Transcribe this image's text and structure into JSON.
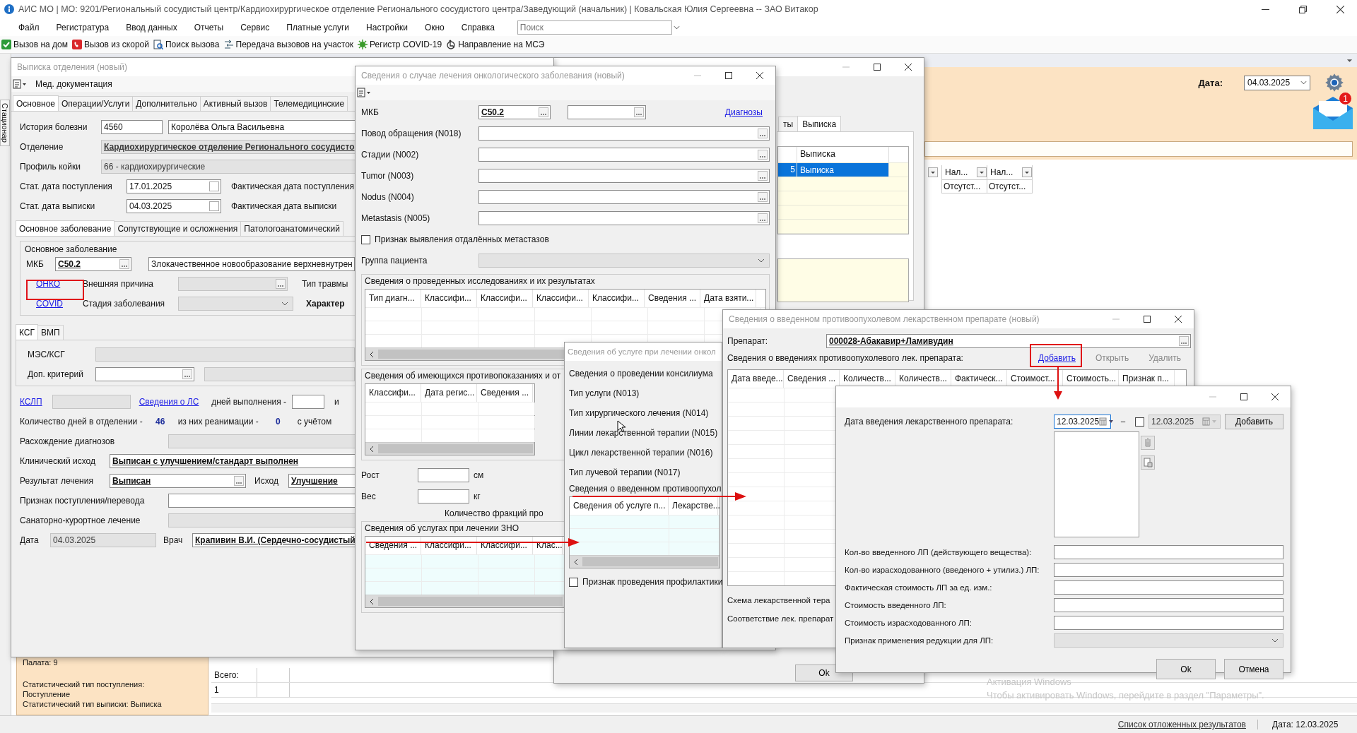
{
  "app": {
    "title": "АИС МО | МО: 9201/Региональный сосудистый центр/Кардиохирургическое отделение Регионального сосудистого центра/Заведующий (начальник) | Ковальская Юлия Сергеевна -- ЗАО Витакор",
    "menu": [
      "Файл",
      "Регистратура",
      "Ввод данных",
      "Отчеты",
      "Сервис",
      "Платные услуги",
      "Настройки",
      "Окно",
      "Справка"
    ],
    "search": {
      "placeholder": "Поиск"
    },
    "toolbar": [
      {
        "kind": "home",
        "label": "Вызов на дом"
      },
      {
        "kind": "ambulance",
        "label": "Вызов из скорой"
      },
      {
        "kind": "find",
        "label": "Поиск вызова"
      },
      {
        "kind": "transfer",
        "label": "Передача вызовов на участок"
      },
      {
        "kind": "virus",
        "label": "Регистр COVID-19"
      },
      {
        "kind": "referral",
        "label": "Направление на МСЭ"
      }
    ]
  },
  "header_panel": {
    "date_label": "Дата:",
    "date": "04.03.2025",
    "mail_badge": "1"
  },
  "main_grid": {
    "columns": [
      "Нал...",
      "Нал..."
    ],
    "rows": [
      [
        "Отсутст...",
        "Отсутст..."
      ]
    ]
  },
  "side_tab": "Стационар",
  "info_panel": [
    "Палата: 9",
    "Статистический тип поступления:",
    "Поступление",
    "Статистический тип выписки: Выписка"
  ],
  "summary": {
    "label": "Всего:",
    "value": "1"
  },
  "activation": [
    "Активация Windows",
    "Чтобы активировать Windows, перейдите в раздел \"Параметры\"."
  ],
  "status_bar": {
    "link": "Список отложенных результатов",
    "date": "Дата: 12.03.2025"
  },
  "behind": {
    "tabs": [
      {
        "label": "ты",
        "selected": false
      },
      {
        "label": "Выписка",
        "selected": true
      }
    ],
    "column": "Выписка",
    "rows": [
      {
        "date": "5",
        "type": "Выписка",
        "selected": true
      }
    ],
    "ok": "Ok"
  },
  "discharge": {
    "title": "Выписка отделения (новый)",
    "doc_menu": "Мед. документация",
    "tabs": [
      {
        "label": "Основное",
        "selected": true
      },
      {
        "label": "Операции/Услуги",
        "selected": false
      },
      {
        "label": "Дополнительно",
        "selected": false
      },
      {
        "label": "Активный вызов",
        "selected": false
      },
      {
        "label": "Телемедицинские",
        "selected": false
      }
    ],
    "history_label": "История болезни",
    "history_no": {
      "kind": "text",
      "value": "4560",
      "disabled": false
    },
    "patient": {
      "kind": "text",
      "value": "Королёва Ольга Васильевна",
      "disabled": false
    },
    "dept_label": "Отделение",
    "dept": {
      "kind": "ref",
      "value": "Кардиохирургическое отделение Регионального сосудисто",
      "disabled": true
    },
    "bed_label": "Профиль койки",
    "bed": {
      "kind": "text",
      "value": "66 - кардиохирургические",
      "disabled": true
    },
    "admit_label": "Стат. дата поступления",
    "admit": {
      "kind": "date",
      "value": "17.01.2025",
      "disabled": false
    },
    "admit_fact_label": "Фактическая дата поступления",
    "disch_label": "Стат. дата выписки",
    "disch": {
      "kind": "date",
      "value": "04.03.2025",
      "disabled": false
    },
    "disch_fact_label": "Фактическая дата выписки",
    "subtabs": [
      {
        "label": "Основное заболевание",
        "selected": true
      },
      {
        "label": "Сопутствующие и осложнения",
        "selected": false
      },
      {
        "label": "Патологоанатомический",
        "selected": false
      }
    ],
    "group_title": "Основное заболевание",
    "mkb_label": "МКБ",
    "mkb": {
      "kind": "lookup",
      "value": "C50.2",
      "disabled": false
    },
    "diag": {
      "kind": "text",
      "value": "Злокачественное новообразование верхневнутрен",
      "disabled": false
    },
    "onko_link": "ОНКО",
    "ext_label": "Внешняя причина",
    "ext": {
      "kind": "lookup",
      "disabled": true
    },
    "trauma_label": "Тип травмы",
    "covid_link": "COVID",
    "stage_label": "Стадия заболевания",
    "stage": {
      "kind": "combo",
      "disabled": true
    },
    "nature_label": "Характер",
    "ksg_tabs": [
      {
        "label": "КСГ",
        "selected": true
      },
      {
        "label": "ВМП",
        "selected": false
      }
    ],
    "mes_label": "МЭС/КСГ",
    "mes": {
      "kind": "text",
      "disabled": true
    },
    "crit_label": "Доп. критерий",
    "crit": {
      "kind": "lookup",
      "disabled": false
    },
    "crit2": {
      "kind": "text",
      "disabled": true
    },
    "kslp_link": "КСЛП",
    "kslp": {
      "kind": "text",
      "disabled": true
    },
    "ls_link": "Сведения о ЛС",
    "days_exec_label": "дней выполнения -",
    "days_exec": {
      "kind": "text",
      "disabled": false
    },
    "days_exec_tail": "и",
    "days_label": "Количество дней в отделении -",
    "days": "46",
    "reanim_label": "из них реанимации -",
    "reanim": "0",
    "account_label": "с учётом",
    "diverg_label": "Расхождение диагнозов",
    "diverg": {
      "kind": "text",
      "disabled": true
    },
    "clin_label": "Клинический исход",
    "clin": {
      "kind": "ref",
      "value": "Выписан с улучшением/стандарт выполнен",
      "disabled": false
    },
    "result_label": "Результат лечения",
    "result": {
      "kind": "lookup",
      "value": "Выписан",
      "disabled": false
    },
    "outcome_label": "Исход",
    "outcome": {
      "kind": "ref",
      "value": "Улучшение",
      "disabled": false
    },
    "admission_label": "Признак поступления/перевода",
    "admission": {
      "kind": "text",
      "disabled": false
    },
    "sanat_label": "Санаторно-курортное лечение",
    "sanat": {
      "kind": "text",
      "disabled": true
    },
    "date_label": "Дата",
    "date": {
      "kind": "text",
      "value": "04.03.2025",
      "disabled": true
    },
    "doctor_label": "Врач",
    "doctor": {
      "kind": "ref",
      "value": "Крапивин В.И. (Сердечно-сосудистый",
      "disabled": false
    }
  },
  "oncology": {
    "title": "Сведения о случае лечения онкологического заболевания (новый)",
    "mkb_label": "МКБ",
    "mkb": {
      "kind": "lookup",
      "value": "C50.2",
      "disabled": false
    },
    "mkb2": {
      "kind": "lookup",
      "disabled": false
    },
    "diagnoses_link": "Диагнозы",
    "fields": [
      {
        "label": "Повод обращения (N018)",
        "field": {
          "kind": "lookup",
          "disabled": false
        }
      },
      {
        "label": "Стадии (N002)",
        "field": {
          "kind": "lookup",
          "disabled": false
        }
      },
      {
        "label": "Tumor (N003)",
        "field": {
          "kind": "lookup",
          "disabled": false
        }
      },
      {
        "label": "Nodus (N004)",
        "field": {
          "kind": "lookup",
          "disabled": false
        }
      },
      {
        "label": "Metastasis (N005)",
        "field": {
          "kind": "lookup",
          "disabled": false
        }
      }
    ],
    "metastases": {
      "label": "Признак выявления отдалённых метастазов",
      "checked": false
    },
    "group_label": "Группа пациента",
    "group": {
      "kind": "combo",
      "disabled": true
    },
    "studies": {
      "title": "Сведения о проведенных исследованиях и их результатах",
      "columns": [
        "Тип диагн...",
        "Классифи...",
        "Классифи...",
        "Классифи...",
        "Классифи...",
        "Сведения ...",
        "Дата взяти..."
      ]
    },
    "contra": {
      "title": "Сведения об имеющихся противопоказаниях и от",
      "columns": [
        "Классифи...",
        "Дата регис...",
        "Сведения ..."
      ]
    },
    "height": {
      "label": "Рост",
      "field": {
        "kind": "text",
        "disabled": false
      },
      "unit": "см"
    },
    "weight": {
      "label": "Вес",
      "field": {
        "kind": "text",
        "disabled": false
      },
      "unit": "кг"
    },
    "fractions_label": "Количество фракций про",
    "services": {
      "title": "Сведения об услугах при лечении ЗНО",
      "columns": [
        "Сведения ...",
        "Классифи...",
        "Классифи...",
        "Клас..."
      ]
    }
  },
  "service": {
    "title": "Сведения об услуге при лечении онкол",
    "items": [
      "Сведения о проведении консилиума",
      "Тип услуги (N013)",
      "Тип хирургического лечения (N014)",
      "Линии лекарственной терапии (N015)",
      "Цикл лекарственной терапии (N016)",
      "Тип лучевой терапии (N017)"
    ],
    "drug_title": "Сведения о введенном противоопухол",
    "columns": [
      "Сведения об услуге п...",
      "Лекарстве..."
    ],
    "prophylaxis": {
      "label": "Признак проведения профилактики",
      "checked": false
    }
  },
  "drug": {
    "title": "Сведения о введенном противоопухолевом лекарственном препарате (новый)",
    "drug_label": "Препарат:",
    "drug": {
      "kind": "lookup",
      "value": "000028-Абакавир+Ламивудин",
      "disabled": false
    },
    "list_label": "Сведения о введениях противоопухолевого лек. препарата:",
    "actions": [
      {
        "label": "Добавить",
        "disabled": false
      },
      {
        "label": "Открыть",
        "disabled": true
      },
      {
        "label": "Удалить",
        "disabled": true
      }
    ],
    "columns": [
      "Дата введе...",
      "Сведения ...",
      "Количеств...",
      "Количеств...",
      "Фактическ...",
      "Стоимост...",
      "Стоимость...",
      "Признак п..."
    ],
    "scheme_label": "Схема лекарственной тера",
    "match_label": "Соответствие лек. препарат"
  },
  "date_dialog": {
    "date_label": "Дата введения лекарственного препарата:",
    "date_from": {
      "kind": "picker",
      "value": "12.03.2025",
      "disabled": false
    },
    "range": {
      "checked": false
    },
    "date_to": {
      "kind": "picker",
      "value": "12.03.2025",
      "disabled": true
    },
    "add": "Добавить",
    "fields": [
      {
        "label": "Кол-во введенного ЛП (действующего вещества):",
        "field": {
          "kind": "text",
          "disabled": false
        }
      },
      {
        "label": "Кол-во израсходованного (введеного + утилиз.) ЛП:",
        "field": {
          "kind": "text",
          "disabled": false
        }
      },
      {
        "label": "Фактическая стоимость ЛП за ед. изм.:",
        "field": {
          "kind": "text",
          "disabled": false
        }
      },
      {
        "label": "Стоимость введенного ЛП:",
        "field": {
          "kind": "text",
          "disabled": false
        }
      },
      {
        "label": "Стоимость израсходованного ЛП:",
        "field": {
          "kind": "text",
          "disabled": false
        }
      },
      {
        "label": "Признак применения редукции для ЛП:",
        "field": {
          "kind": "combo",
          "disabled": true
        }
      }
    ],
    "ok": "Ok",
    "cancel": "Отмена"
  }
}
